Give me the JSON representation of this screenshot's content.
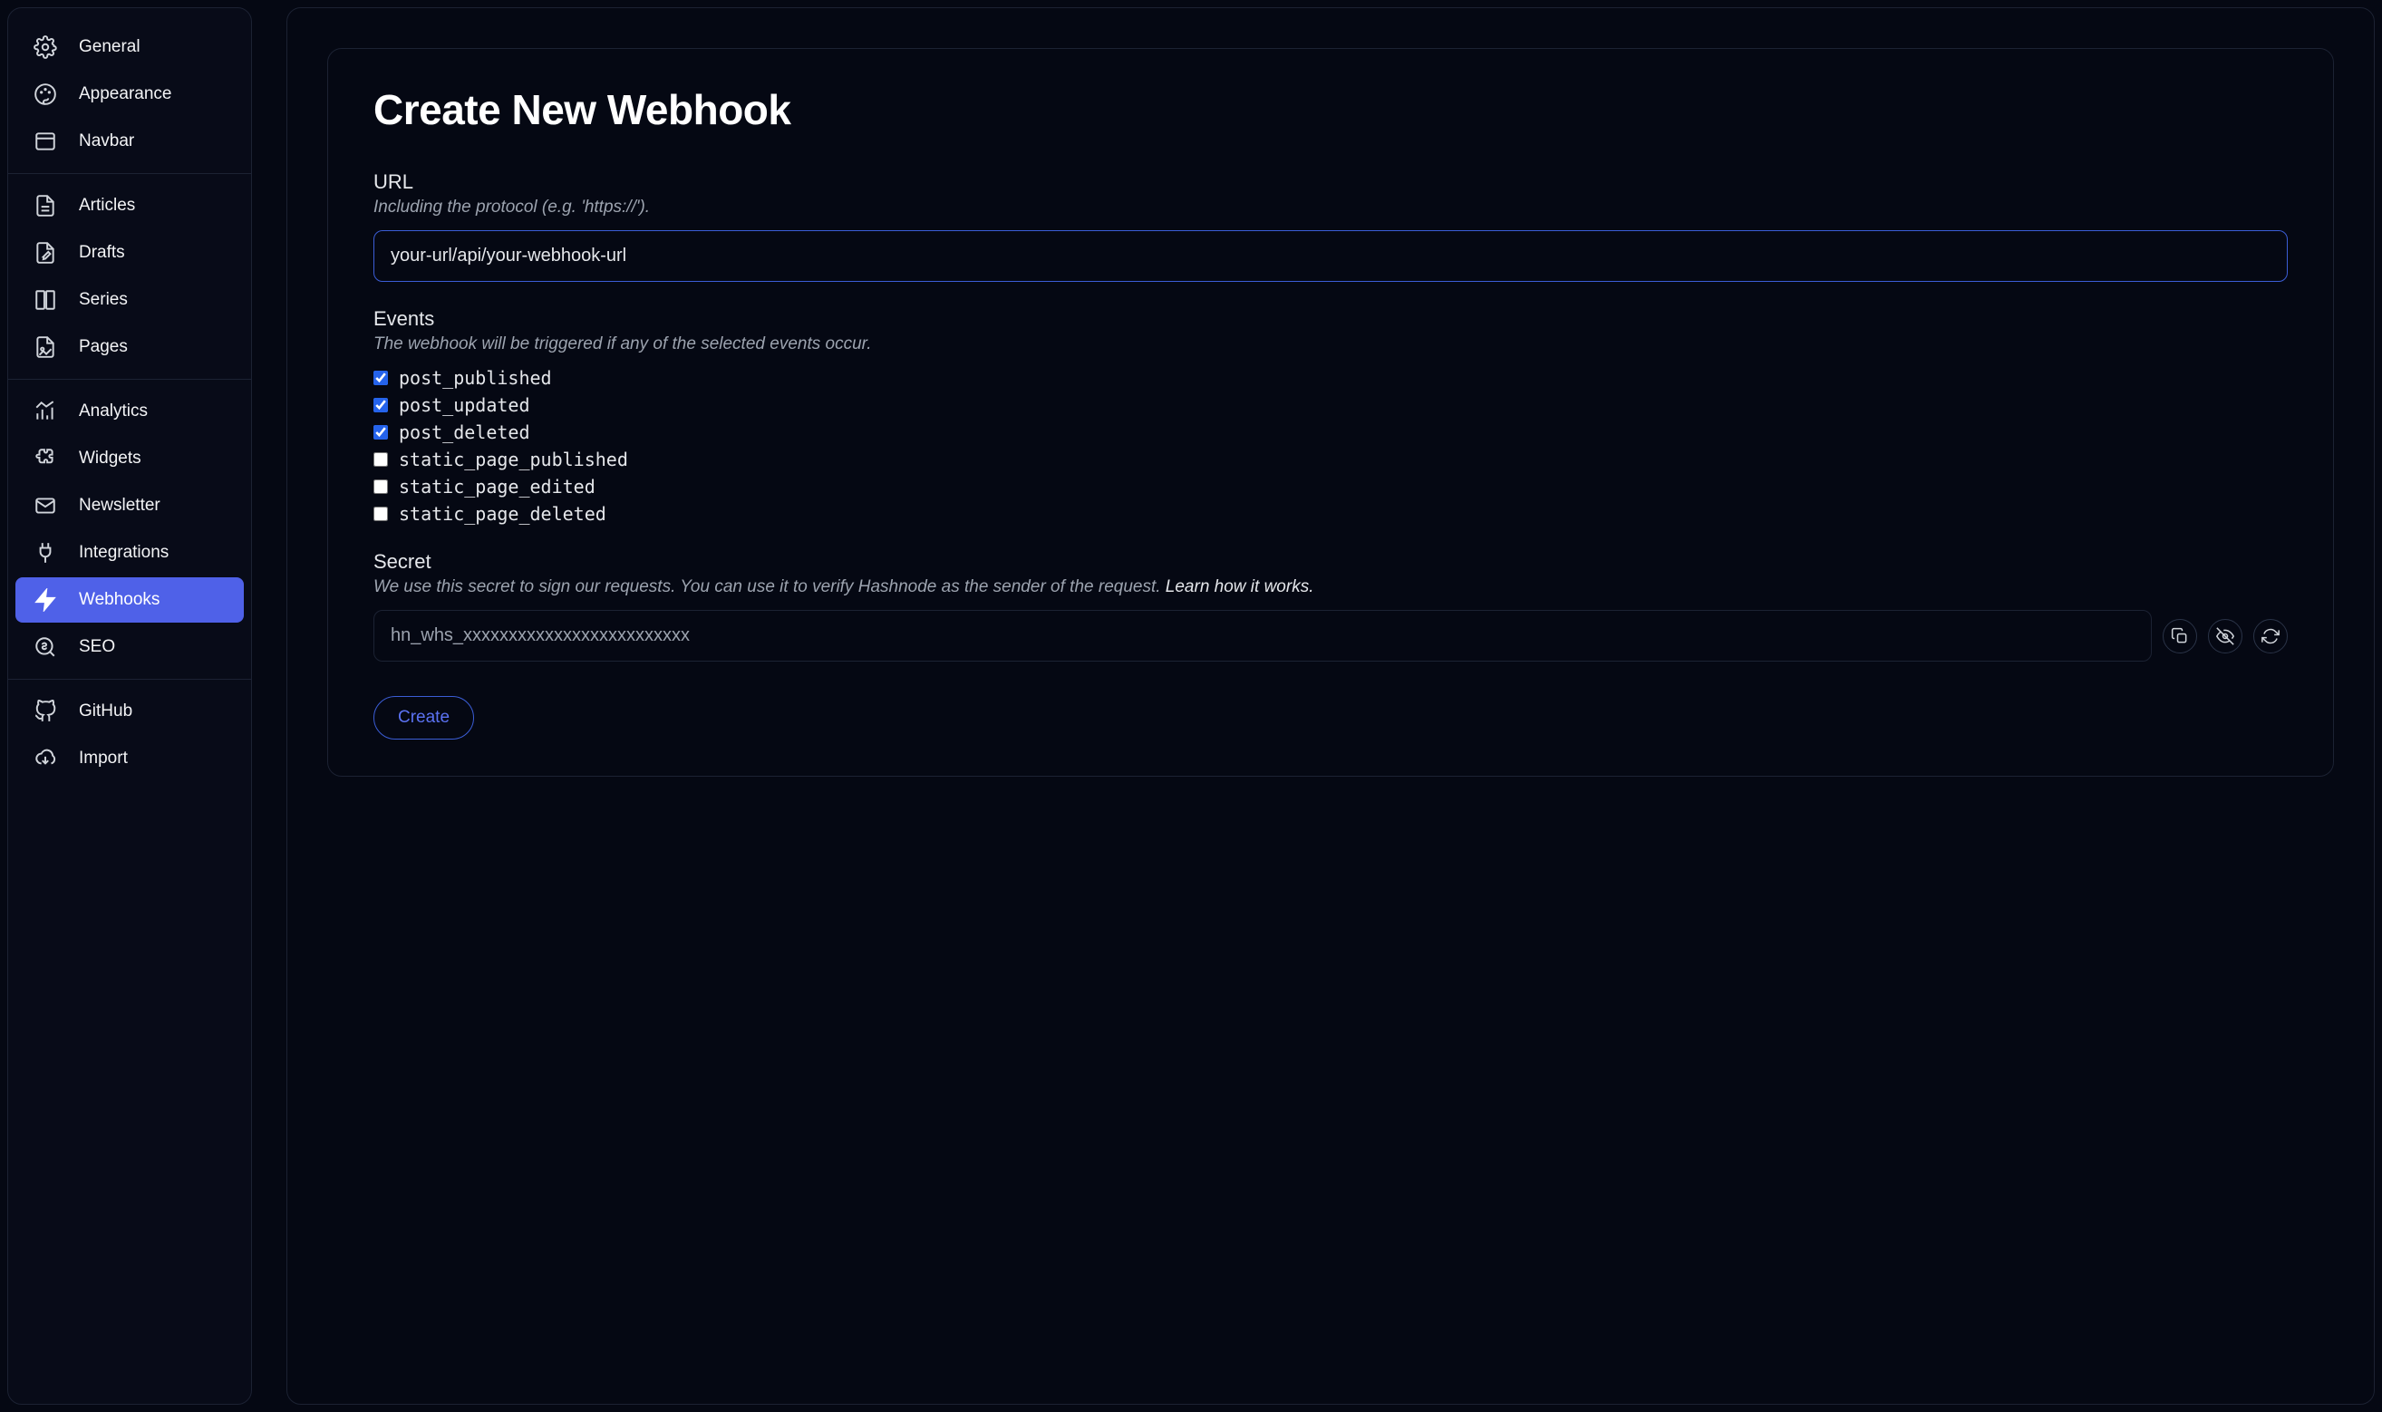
{
  "sidebar": {
    "groups": [
      {
        "items": [
          {
            "label": "General",
            "icon": "gear-icon"
          },
          {
            "label": "Appearance",
            "icon": "palette-icon"
          },
          {
            "label": "Navbar",
            "icon": "layout-icon"
          }
        ]
      },
      {
        "items": [
          {
            "label": "Articles",
            "icon": "document-icon"
          },
          {
            "label": "Drafts",
            "icon": "edit-document-icon"
          },
          {
            "label": "Series",
            "icon": "columns-icon"
          },
          {
            "label": "Pages",
            "icon": "image-document-icon"
          }
        ]
      },
      {
        "items": [
          {
            "label": "Analytics",
            "icon": "chart-icon"
          },
          {
            "label": "Widgets",
            "icon": "puzzle-icon"
          },
          {
            "label": "Newsletter",
            "icon": "envelope-icon"
          },
          {
            "label": "Integrations",
            "icon": "plug-icon"
          },
          {
            "label": "Webhooks",
            "icon": "bolt-icon",
            "active": true
          },
          {
            "label": "SEO",
            "icon": "search-dollar-icon"
          }
        ]
      },
      {
        "items": [
          {
            "label": "GitHub",
            "icon": "github-icon"
          },
          {
            "label": "Import",
            "icon": "cloud-download-icon"
          }
        ]
      }
    ]
  },
  "page": {
    "title": "Create New Webhook",
    "url_section": {
      "label": "URL",
      "hint": "Including the protocol (e.g. 'https://').",
      "value": "your-url/api/your-webhook-url"
    },
    "events_section": {
      "label": "Events",
      "hint": "The webhook will be triggered if any of the selected events occur.",
      "items": [
        {
          "name": "post_published",
          "checked": true
        },
        {
          "name": "post_updated",
          "checked": true
        },
        {
          "name": "post_deleted",
          "checked": true
        },
        {
          "name": "static_page_published",
          "checked": false
        },
        {
          "name": "static_page_edited",
          "checked": false
        },
        {
          "name": "static_page_deleted",
          "checked": false
        }
      ]
    },
    "secret_section": {
      "label": "Secret",
      "hint_prefix": "We use this secret to sign our requests. You can use it to verify Hashnode as the sender of the request. ",
      "hint_link": "Learn how it works.",
      "value": "hn_whs_xxxxxxxxxxxxxxxxxxxxxxxxx"
    },
    "create_button": "Create"
  }
}
